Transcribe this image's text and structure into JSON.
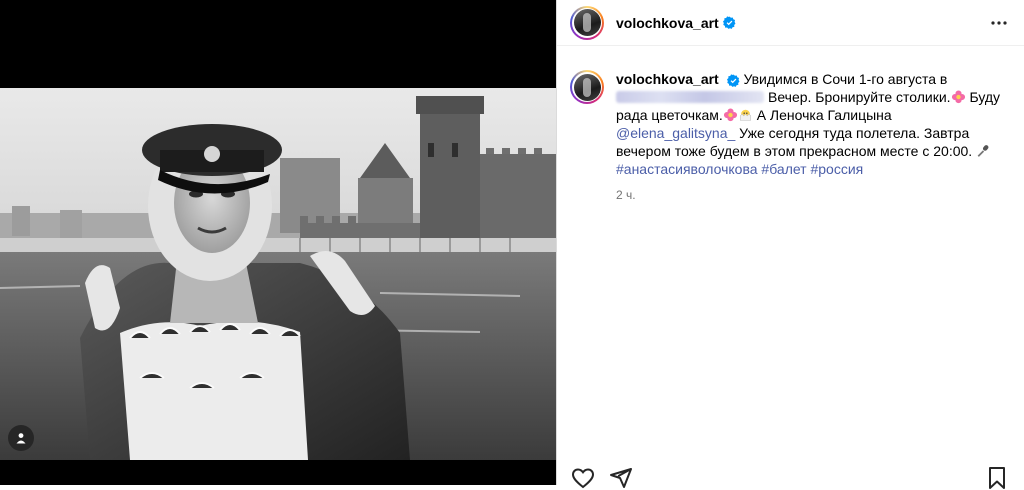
{
  "post": {
    "username": "volochkova_art",
    "caption": {
      "username": "volochkova_art",
      "line1": "Увидимся в Сочи 1-го августа в",
      "hidden_link_alt": "",
      "segment2": "Вечер. Бронируйте столики.",
      "segment3": " Буду рада цветочкам.",
      "segment4": " А Леночка Галицына ",
      "mention": "@elena_galitsyna_",
      "segment5": " Уже сегодня туда полетела. Завтра вечером тоже будем в этом прекрасном месте с 20:00. ",
      "hashtag1": "#анастасияволочкова",
      "hashtag2": "#балет",
      "hashtag3": "#россия"
    },
    "timestamp": "2 ч."
  },
  "icons": {
    "verified": "verified-badge-icon",
    "more": "more-options-icon",
    "tag": "user-tag-icon",
    "like": "heart-icon",
    "share": "share-icon",
    "save": "bookmark-icon"
  },
  "colors": {
    "verified": "#0095f6",
    "link": "#4b5ea8",
    "muted": "#737373"
  }
}
